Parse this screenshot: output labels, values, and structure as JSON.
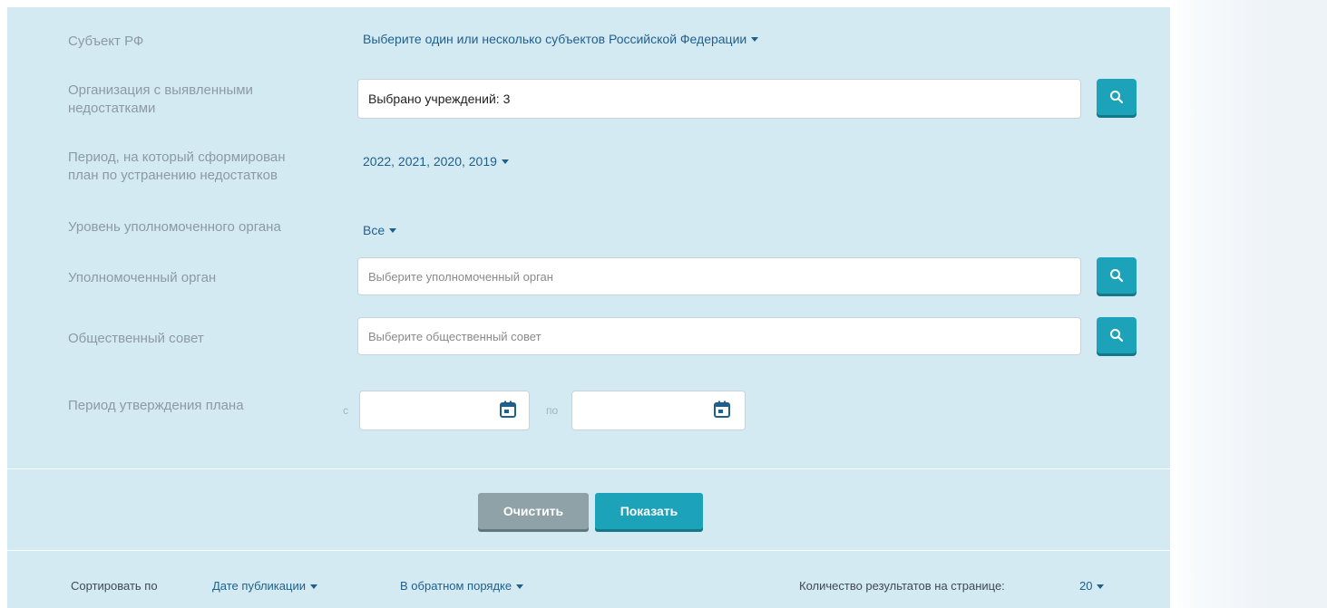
{
  "filters": {
    "subject": {
      "label": "Субъект РФ",
      "value": "Выберите один или несколько субъектов Российской Федерации"
    },
    "organization": {
      "label_line1": "Организация с выявленными",
      "label_line2": "недостатками",
      "value": "Выбрано учреждений: 3"
    },
    "period": {
      "label_line1": "Период, на который сформирован",
      "label_line2": "план по устранению недостатков",
      "value": "2022, 2021, 2020, 2019"
    },
    "level": {
      "label": "Уровень уполномоченного органа",
      "value": "Все"
    },
    "authority": {
      "label": "Уполномоченный орган",
      "placeholder": "Выберите уполномоченный орган"
    },
    "council": {
      "label": "Общественный совет",
      "placeholder": "Выберите общественный совет"
    },
    "approval_period": {
      "label": "Период утверждения плана",
      "from_label": "с",
      "to_label": "по"
    }
  },
  "actions": {
    "clear_label": "Очистить",
    "show_label": "Показать"
  },
  "sorting": {
    "sort_by_label": "Сортировать по",
    "sort_field": "Дате публикации",
    "sort_order": "В обратном порядке",
    "per_page_label": "Количество результатов на странице:",
    "per_page_value": "20"
  },
  "icons": {
    "search": "search-icon",
    "calendar": "calendar-icon",
    "dropdown": "caret-down-icon"
  },
  "colors": {
    "panel_bg": "#d4eaf3",
    "accent": "#1da3b9",
    "link": "#1f5f8c",
    "clear_button": "#8ea2a8"
  }
}
